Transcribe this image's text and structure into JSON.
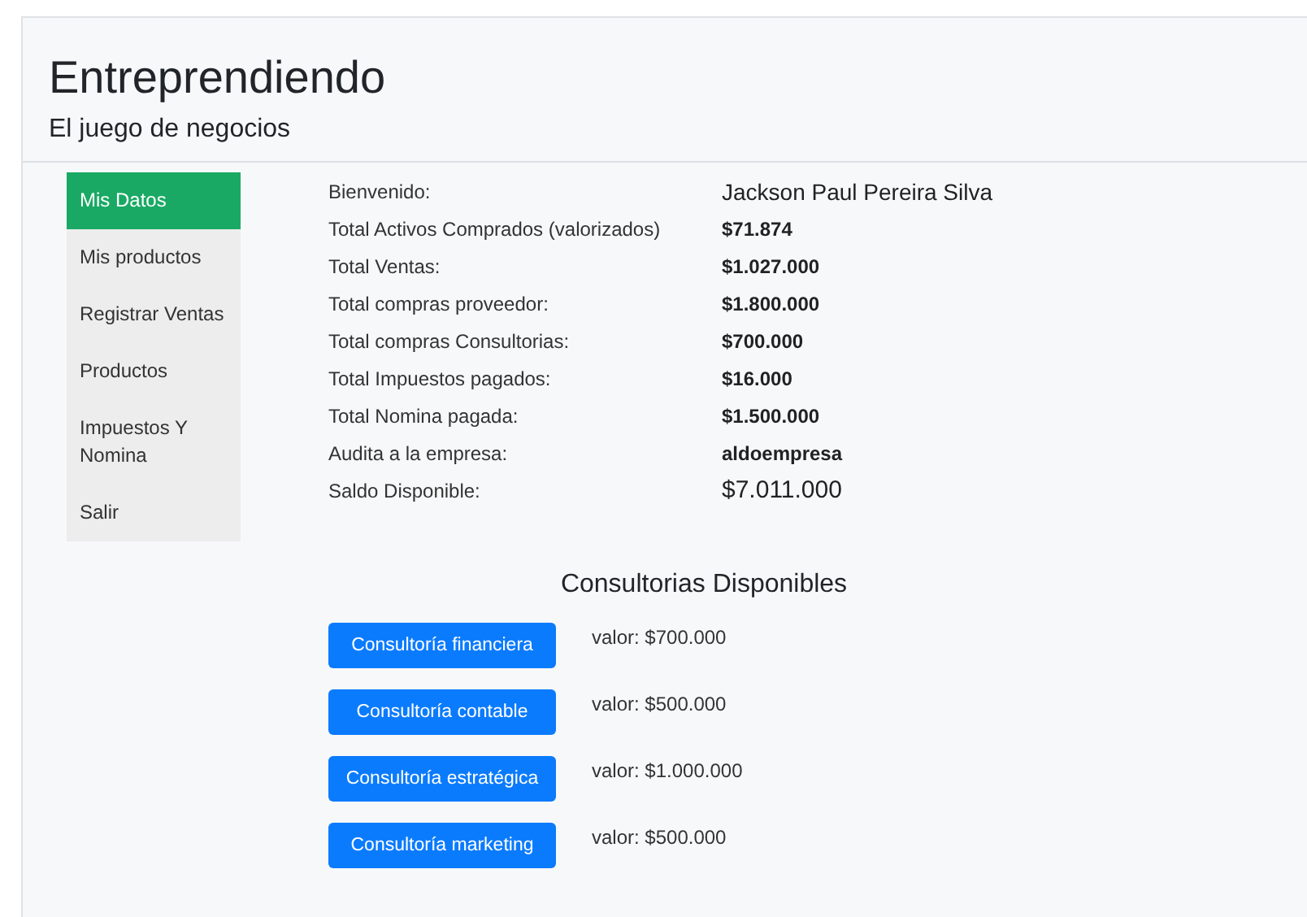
{
  "header": {
    "title": "Entreprendiendo",
    "subtitle": "El juego de negocios"
  },
  "sidebar": {
    "items": [
      {
        "label": "Mis Datos",
        "selected": true
      },
      {
        "label": "Mis productos",
        "selected": false
      },
      {
        "label": "Registrar Ventas",
        "selected": false
      },
      {
        "label": "Productos",
        "selected": false
      },
      {
        "label": "Impuestos Y Nomina",
        "selected": false
      },
      {
        "label": "Salir",
        "selected": false
      }
    ]
  },
  "summary": [
    {
      "label": "Bienvenido:",
      "value": "Jackson Paul Pereira Silva",
      "kind": "large"
    },
    {
      "label": "Total Activos Comprados (valorizados)",
      "value": "$71.874",
      "kind": "normal"
    },
    {
      "label": "Total Ventas:",
      "value": "$1.027.000",
      "kind": "normal"
    },
    {
      "label": "Total compras proveedor:",
      "value": "$1.800.000",
      "kind": "normal"
    },
    {
      "label": "Total compras Consultorias:",
      "value": "$700.000",
      "kind": "normal"
    },
    {
      "label": "Total Impuestos pagados:",
      "value": "$16.000",
      "kind": "normal"
    },
    {
      "label": "Total Nomina pagada:",
      "value": "$1.500.000",
      "kind": "normal"
    },
    {
      "label": "Audita a la empresa:",
      "value": "aldoempresa",
      "kind": "normal"
    },
    {
      "label": "Saldo Disponible:",
      "value": "$7.011.000",
      "kind": "total"
    }
  ],
  "consultancies": {
    "title": "Consultorias Disponibles",
    "items": [
      {
        "button": "Consultoría financiera",
        "price": "valor: $700.000"
      },
      {
        "button": "Consultoría contable",
        "price": "valor: $500.000"
      },
      {
        "button": "Consultoría estratégica",
        "price": "valor: $1.000.000"
      },
      {
        "button": "Consultoría marketing",
        "price": "valor: $500.000"
      }
    ]
  }
}
